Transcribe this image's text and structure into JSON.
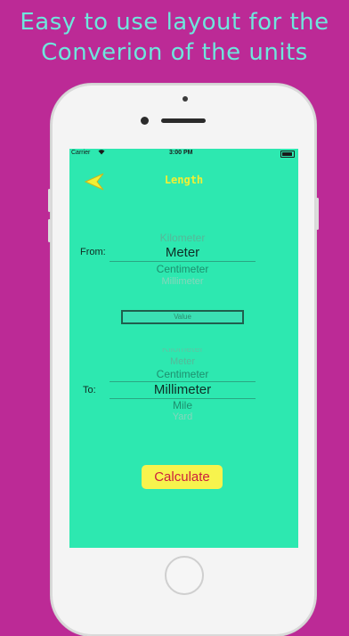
{
  "headline": {
    "line1": "Easy to use layout for the",
    "line2": "Converion of the units"
  },
  "status_bar": {
    "carrier": "Carrier",
    "wifi_icon": "wifi-icon",
    "time": "3:00 PM",
    "battery_icon": "battery-icon"
  },
  "nav": {
    "back_icon": "back-arrow-icon",
    "title": "Length"
  },
  "from": {
    "label": "From:",
    "items": [
      "Kilometer",
      "Meter",
      "Centimeter",
      "Millimeter"
    ],
    "selected": "Meter"
  },
  "value_input": {
    "placeholder": "Value"
  },
  "to": {
    "label": "To:",
    "items": [
      "Kilometer",
      "Meter",
      "Centimeter",
      "Millimeter",
      "Mile",
      "Yard"
    ],
    "selected": "Millimeter"
  },
  "calculate_label": "Calculate",
  "colors": {
    "background": "#bc2a96",
    "screen": "#2de8b0",
    "headline": "#6ee6dc",
    "title": "#f2ef33",
    "button_bg": "#f7f34d",
    "button_text": "#cc1f3d"
  }
}
